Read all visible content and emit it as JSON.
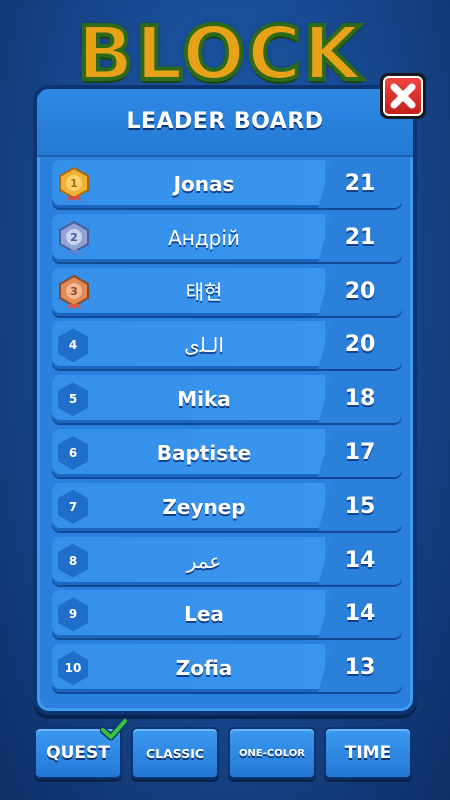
{
  "logo": {
    "text": "BLOCK"
  },
  "leaderboard": {
    "title": "LEADER BOARD",
    "rows": [
      {
        "rank": "1",
        "name": "Jonas",
        "score": "21",
        "medal": "gold-medal"
      },
      {
        "rank": "2",
        "name": "Андрій",
        "score": "21",
        "medal": "silver-medal"
      },
      {
        "rank": "3",
        "name": "태현",
        "score": "20",
        "medal": "bronze-medal"
      },
      {
        "rank": "4",
        "name": "الـﻠى",
        "score": "20"
      },
      {
        "rank": "5",
        "name": "Mika",
        "score": "18"
      },
      {
        "rank": "6",
        "name": "Baptiste",
        "score": "17"
      },
      {
        "rank": "7",
        "name": "Zeynep",
        "score": "15"
      },
      {
        "rank": "8",
        "name": "عمر",
        "score": "14"
      },
      {
        "rank": "9",
        "name": "Lea",
        "score": "14"
      },
      {
        "rank": "10",
        "name": "Zofia",
        "score": "13"
      }
    ]
  },
  "modes": {
    "quest": "QUEST",
    "classic": "CLASSIC",
    "one_color": "ONE-COLOR",
    "time": "TIME"
  },
  "colors": {
    "panel": "#2a80dc",
    "close": "#e33a33",
    "check": "#37c43a",
    "gold": "#f2b134",
    "silver": "#8fa3d6",
    "bronze": "#e08a58"
  }
}
